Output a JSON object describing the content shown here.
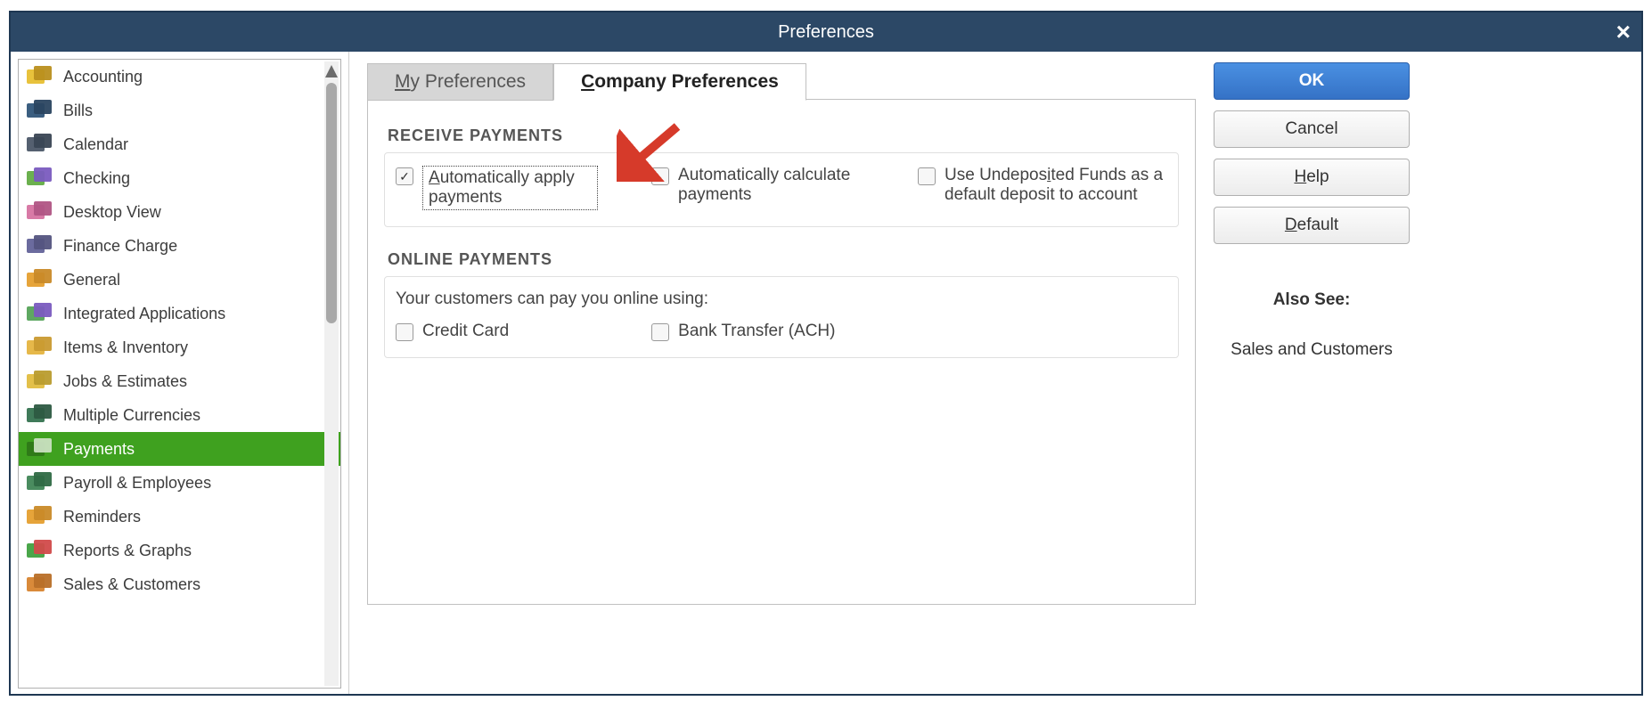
{
  "window": {
    "title": "Preferences"
  },
  "sidebar": {
    "items": [
      {
        "label": "Accounting",
        "icon_fill": "#e8c23c",
        "icon_fill2": "#b98f1e"
      },
      {
        "label": "Bills",
        "icon_fill": "#3b5e80",
        "icon_fill2": "#2a4560"
      },
      {
        "label": "Calendar",
        "icon_fill": "#556070",
        "icon_fill2": "#3a4654"
      },
      {
        "label": "Checking",
        "icon_fill": "#6bb04e",
        "icon_fill2": "#7a5bbf"
      },
      {
        "label": "Desktop View",
        "icon_fill": "#d87aa6",
        "icon_fill2": "#b05584"
      },
      {
        "label": "Finance Charge",
        "icon_fill": "#6b6b9e",
        "icon_fill2": "#54547f"
      },
      {
        "label": "General",
        "icon_fill": "#e6a43a",
        "icon_fill2": "#c98a28"
      },
      {
        "label": "Integrated Applications",
        "icon_fill": "#5ea861",
        "icon_fill2": "#7a5bbf"
      },
      {
        "label": "Items & Inventory",
        "icon_fill": "#e6b84a",
        "icon_fill2": "#c99a30"
      },
      {
        "label": "Jobs & Estimates",
        "icon_fill": "#e3c04a",
        "icon_fill2": "#b99c2e"
      },
      {
        "label": "Multiple Currencies",
        "icon_fill": "#3f7a59",
        "icon_fill2": "#2d5a42"
      },
      {
        "label": "Payments",
        "icon_fill": "#2f7a18",
        "icon_fill2": "#c9e0c0",
        "selected": true
      },
      {
        "label": "Payroll & Employees",
        "icon_fill": "#4a8c5f",
        "icon_fill2": "#2f6a45"
      },
      {
        "label": "Reminders",
        "icon_fill": "#e6a43a",
        "icon_fill2": "#c98a28"
      },
      {
        "label": "Reports & Graphs",
        "icon_fill": "#4aa64a",
        "icon_fill2": "#d14a4a"
      },
      {
        "label": "Sales & Customers",
        "icon_fill": "#d98a3a",
        "icon_fill2": "#b86f28"
      }
    ]
  },
  "tabs": {
    "my_pref_pre": "M",
    "my_pref_rest": "y Preferences",
    "co_pref_pre": "C",
    "co_pref_rest": "ompany Preferences"
  },
  "receive": {
    "heading": "RECEIVE PAYMENTS",
    "auto_apply_pre": "A",
    "auto_apply_rest": "utomatically apply payments",
    "auto_calc": "Automatically calculate payments",
    "undeposited_pre": "Use Undepos",
    "undeposited_u": "i",
    "undeposited_rest": "ted Funds as a default deposit to account"
  },
  "online": {
    "heading": "ONLINE PAYMENTS",
    "desc": "Your customers can pay you online using:",
    "credit": "Credit Card",
    "ach": "Bank Transfer (ACH)"
  },
  "buttons": {
    "ok": "OK",
    "cancel": "Cancel",
    "help_pre": "H",
    "help_rest": "elp",
    "default_pre": "D",
    "default_rest": "efault"
  },
  "also_see": {
    "title": "Also See:",
    "link": "Sales and Customers"
  }
}
